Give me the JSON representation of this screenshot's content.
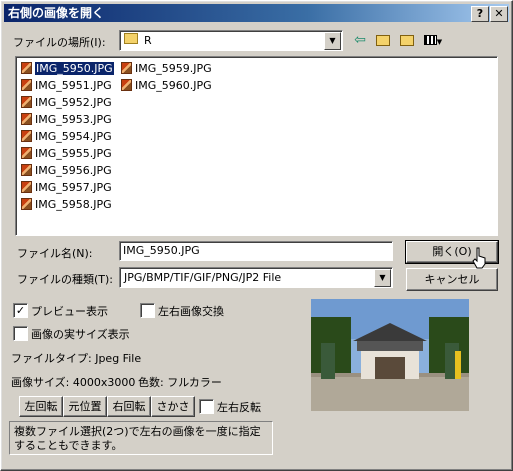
{
  "window": {
    "title": "右側の画像を開く"
  },
  "title_buttons": {
    "help": "?",
    "close": "✕"
  },
  "look_in": {
    "label": "ファイルの場所(I):",
    "value": "R"
  },
  "files_col1": [
    "IMG_5950.JPG",
    "IMG_5951.JPG",
    "IMG_5952.JPG",
    "IMG_5953.JPG",
    "IMG_5954.JPG",
    "IMG_5955.JPG",
    "IMG_5956.JPG",
    "IMG_5957.JPG",
    "IMG_5958.JPG"
  ],
  "files_col2": [
    "IMG_5959.JPG",
    "IMG_5960.JPG"
  ],
  "filename": {
    "label": "ファイル名(N):",
    "value": "IMG_5950.JPG"
  },
  "filetype": {
    "label": "ファイルの種類(T):",
    "value": "JPG/BMP/TIF/GIF/PNG/JP2 File"
  },
  "buttons": {
    "open": "開く(O)",
    "cancel": "キャンセル"
  },
  "options": {
    "preview": {
      "label": "プレビュー表示",
      "checked": true
    },
    "swap": {
      "label": "左右画像交換",
      "checked": false
    },
    "actual_size": {
      "label": "画像の実サイズ表示",
      "checked": false
    },
    "mirror": {
      "label": "左右反転",
      "checked": false
    }
  },
  "info": {
    "filetype": "ファイルタイプ: Jpeg File",
    "imagesize": "画像サイズ: 4000x3000",
    "colors": "色数: フルカラー"
  },
  "rotate_buttons": {
    "left": "左回転",
    "original": "元位置",
    "right": "右回転",
    "flip": "さかさ"
  },
  "hint": "複数ファイル選択(2つ)で左右の画像を一度に指定することもできます。",
  "icons": {
    "back": "back-arrow-icon",
    "up": "up-folder-icon",
    "new": "new-folder-icon",
    "view": "view-menu-icon",
    "folder": "folder-icon"
  }
}
